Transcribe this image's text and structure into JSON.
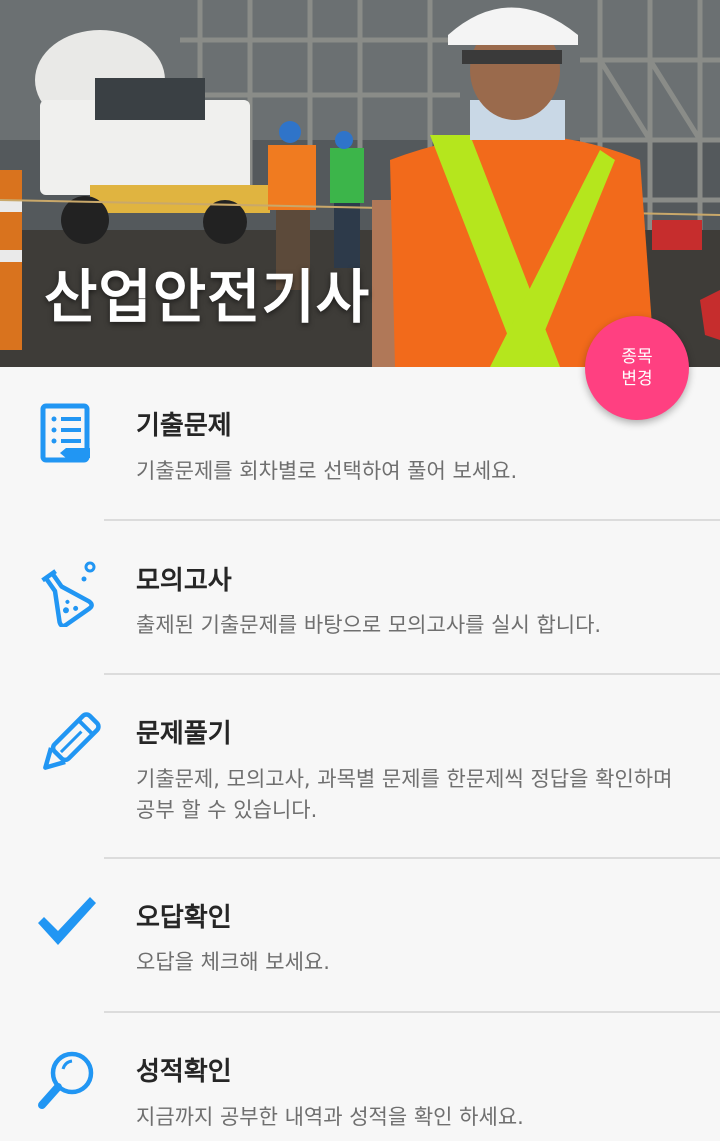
{
  "header": {
    "title": "산업안전기사",
    "change_button": {
      "line1": "종목",
      "line2": "변경"
    }
  },
  "menu": [
    {
      "title": "기출문제",
      "description": "기출문제를 회차별로 선택하여 풀어 보세요.",
      "icon": "document-list-icon"
    },
    {
      "title": "모의고사",
      "description": "출제된 기출문제를 바탕으로 모의고사를 실시 합니다.",
      "icon": "flask-icon"
    },
    {
      "title": "문제풀기",
      "description": "기출문제, 모의고사, 과목별 문제를 한문제씩 정답을 확인하며 공부 할 수 있습니다.",
      "icon": "pencil-icon"
    },
    {
      "title": "오답확인",
      "description": "오답을 체크해 보세요.",
      "icon": "checkmark-icon"
    },
    {
      "title": "성적확인",
      "description": "지금까지 공부한 내역과 성적을 확인 하세요.",
      "icon": "magnifier-icon"
    }
  ],
  "colors": {
    "accent_blue": "#2196f3",
    "fab_pink": "#ff4081"
  }
}
